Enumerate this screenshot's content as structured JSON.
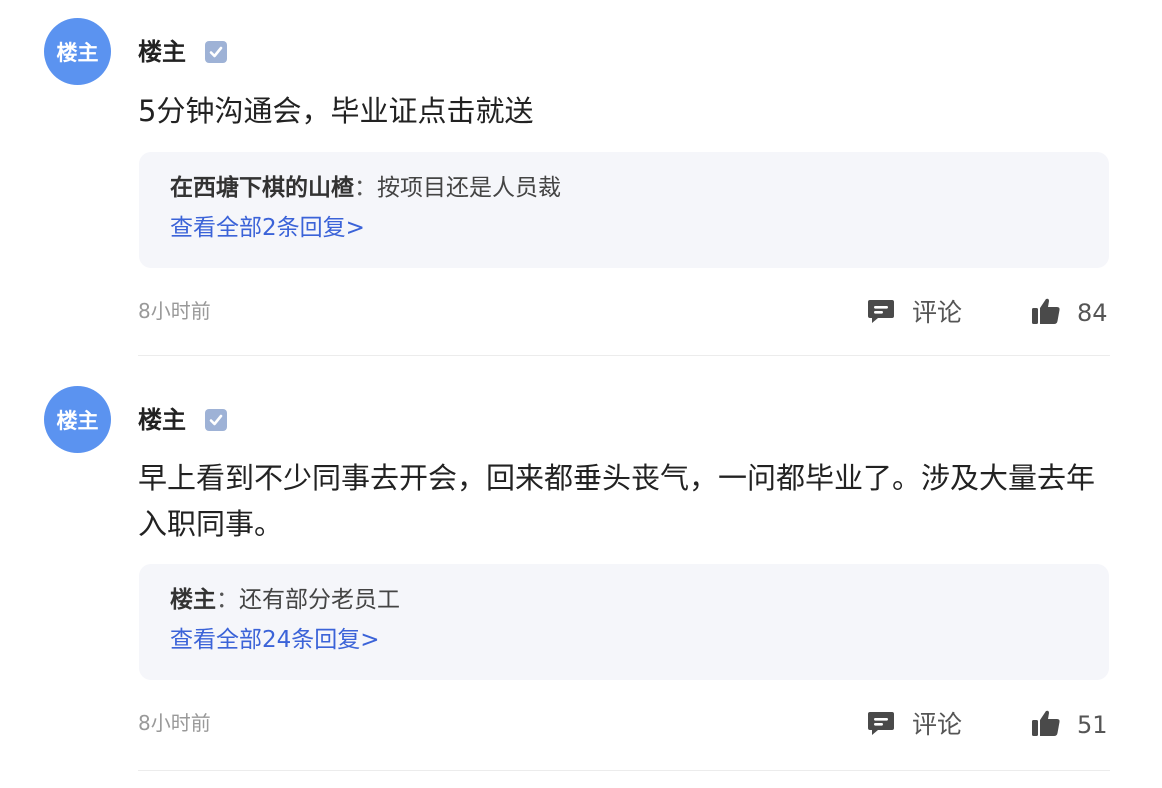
{
  "comments": [
    {
      "avatar_text": "楼主",
      "username": "楼主",
      "verified_icon": "verified-badge-icon",
      "text": "5分钟沟通会，毕业证点击就送",
      "reply": {
        "author": "在西塘下棋的山楂",
        "separator": "：",
        "text": "按项目还是人员裁",
        "view_all": "查看全部2条回复>"
      },
      "time": "8小时前",
      "comment_label": "评论",
      "like_count": "84"
    },
    {
      "avatar_text": "楼主",
      "username": "楼主",
      "verified_icon": "verified-badge-icon",
      "text": "早上看到不少同事去开会，回来都垂头丧气，一问都毕业了。涉及大量去年入职同事。",
      "reply": {
        "author": "楼主",
        "separator": "：",
        "text": "还有部分老员工",
        "view_all": "查看全部24条回复>"
      },
      "time": "8小时前",
      "comment_label": "评论",
      "like_count": "51"
    }
  ],
  "colors": {
    "avatar": "#5b93f0",
    "link": "#3b63d8",
    "reply_bg": "#f5f6fa",
    "muted": "#999999"
  }
}
